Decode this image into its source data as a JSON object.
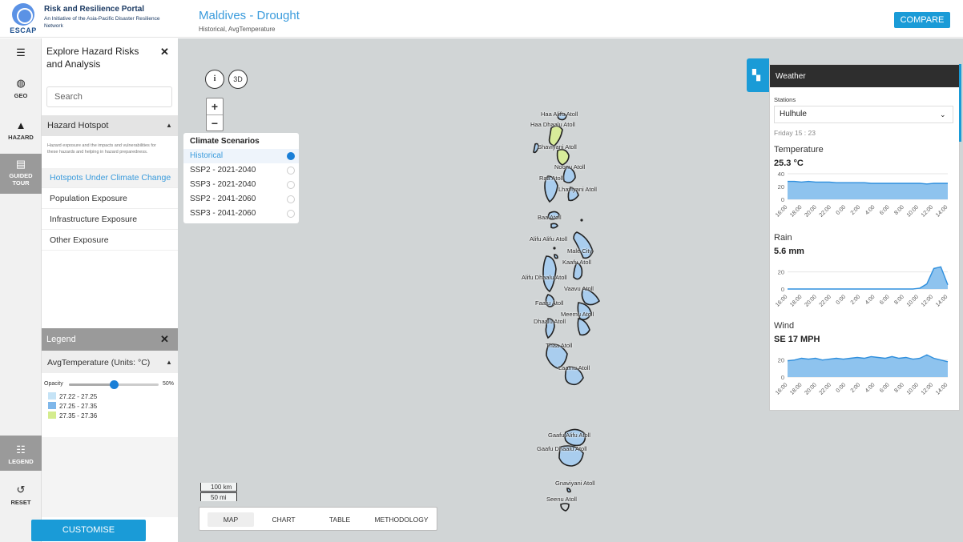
{
  "header": {
    "logo_text": "ESCAP",
    "portal_title": "Risk and Resilience Portal",
    "portal_subtitle": "An Initiative of the Asia-Pacific Disaster Resilience Network",
    "page_title": "Maldives - Drought",
    "page_subtitle": "Historical, AvgTemperature",
    "compare_label": "COMPARE"
  },
  "rail": {
    "geo": "GEO",
    "hazard": "HAZARD",
    "guided_tour_1": "GUIDED",
    "guided_tour_2": "TOUR",
    "legend": "LEGEND",
    "reset": "RESET"
  },
  "panel": {
    "title": "Explore Hazard Risks and Analysis",
    "search_placeholder": "Search",
    "section": "Hazard Hotspot",
    "description": "Hazard exposure and the impacts and vulnerabilities for these hazards and helping in hazard preparedness.",
    "items": [
      {
        "label": "Hotspots Under Climate Change",
        "active": true
      },
      {
        "label": "Population Exposure",
        "active": false
      },
      {
        "label": "Infrastructure Exposure",
        "active": false
      },
      {
        "label": "Other Exposure",
        "active": false
      }
    ]
  },
  "legend": {
    "title": "Legend",
    "layer": "AvgTemperature (Units: °C)",
    "opacity_label": "Opacity",
    "opacity_value": "50%",
    "opacity_fraction": 0.5,
    "classes": [
      {
        "label": "27.22 - 27.25",
        "color": "#c5e3f6"
      },
      {
        "label": "27.25 - 27.35",
        "color": "#7fb7ea"
      },
      {
        "label": "27.35 - 27.36",
        "color": "#d4ec8e"
      }
    ]
  },
  "customise_label": "CUSTOMISE",
  "map": {
    "info_label": "i",
    "three_d_label": "3D",
    "zoom_in": "+",
    "zoom_out": "−",
    "scale_km": "100 km",
    "scale_mi": "50 mi",
    "atolls": [
      "Haa Alifu Atoll",
      "Haa Dhaalu Atoll",
      "Shaviyani Atoll",
      "Noonu Atoll",
      "Raa Atoll",
      "Lhaviyani Atoll",
      "Baa Atoll",
      "Alifu Alifu Atoll",
      "Malé City",
      "Kaafu Atoll",
      "Alifu Dhaalu Atoll",
      "Vaavu Atoll",
      "Faafu Atoll",
      "Meemu Atoll",
      "Dhaalu Atoll",
      "Thaa Atoll",
      "Laamu Atoll",
      "Gaafu Alifu Atoll",
      "Gaafu Dhaalu Atoll",
      "Gnaviyani Atoll",
      "Seenu Atoll"
    ]
  },
  "scenarios": {
    "title": "Climate Scenarios",
    "items": [
      {
        "label": "Historical",
        "selected": true
      },
      {
        "label": "SSP2 - 2021-2040",
        "selected": false
      },
      {
        "label": "SSP3 - 2021-2040",
        "selected": false
      },
      {
        "label": "SSP2 - 2041-2060",
        "selected": false
      },
      {
        "label": "SSP3 - 2041-2060",
        "selected": false
      }
    ]
  },
  "weather": {
    "title": "Weather",
    "stations_label": "Stations",
    "station": "Hulhule",
    "time": "Friday 15 : 23",
    "x_labels": [
      "16:00",
      "18:00",
      "20:00",
      "22:00",
      "0:00",
      "2:00",
      "4:00",
      "6:00",
      "8:00",
      "10:00",
      "12:00",
      "14:00"
    ],
    "temperature": {
      "label": "Temperature",
      "value": "25.3 °C",
      "ticks": [
        "40",
        "20",
        "0"
      ],
      "ymax": 40,
      "series": [
        28,
        28,
        27,
        28,
        27,
        27,
        27,
        26,
        26,
        26,
        26,
        26,
        25,
        25,
        25,
        25,
        25,
        25,
        25,
        25,
        24,
        25,
        25,
        25
      ]
    },
    "rain": {
      "label": "Rain",
      "value": "5.6 mm",
      "ticks": [
        "20",
        "0"
      ],
      "ymax": 30,
      "series": [
        0,
        0,
        0,
        0,
        0,
        0,
        0,
        0,
        0,
        0,
        0,
        0,
        0,
        0,
        0,
        0,
        0,
        0,
        0,
        1,
        6,
        24,
        26,
        5
      ]
    },
    "wind": {
      "label": "Wind",
      "value": "SE 17 MPH",
      "ticks": [
        "20",
        "0"
      ],
      "ymax": 30,
      "series": [
        19,
        20,
        22,
        21,
        22,
        20,
        21,
        22,
        21,
        22,
        23,
        22,
        24,
        23,
        22,
        24,
        22,
        23,
        21,
        22,
        26,
        22,
        20,
        18
      ]
    }
  },
  "tabs": [
    {
      "label": "MAP",
      "active": true
    },
    {
      "label": "CHART",
      "active": false
    },
    {
      "label": "TABLE",
      "active": false
    },
    {
      "label": "METHODOLOGY",
      "active": false
    }
  ]
}
